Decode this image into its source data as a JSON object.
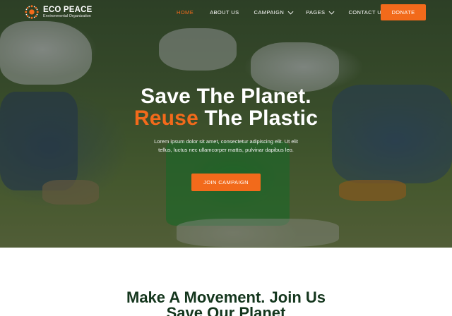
{
  "brand": {
    "name": "ECO PEACE",
    "tagline": "Environmental Organization",
    "logo_icon": "sun-logo-icon"
  },
  "nav": {
    "items": [
      {
        "label": "HOME",
        "active": true
      },
      {
        "label": "ABOUT US",
        "active": false
      },
      {
        "label": "CAMPAIGN",
        "active": false,
        "dropdown": true
      },
      {
        "label": "PAGES",
        "active": false,
        "dropdown": true
      },
      {
        "label": "CONTACT US",
        "active": false
      }
    ],
    "donate_label": "DONATE"
  },
  "hero": {
    "headline_line1": "Save The Planet.",
    "headline_accent": "Reuse",
    "headline_line2_rest": " The Plastic",
    "text_line1": "Lorem ipsum dolor sit amet, consectetur adipiscing elit. Ut elit",
    "text_line2": "tellus, luctus nec ullamcorper mattis, pulvinar dapibus leo.",
    "cta_label": "JOIN CAMPAIGN"
  },
  "section": {
    "title_line1": "Make A Movement. Join Us",
    "title_line2": "Save Our Planet"
  },
  "colors": {
    "accent": "#f26a1b",
    "heading_dark_green": "#14361d",
    "white": "#ffffff"
  }
}
